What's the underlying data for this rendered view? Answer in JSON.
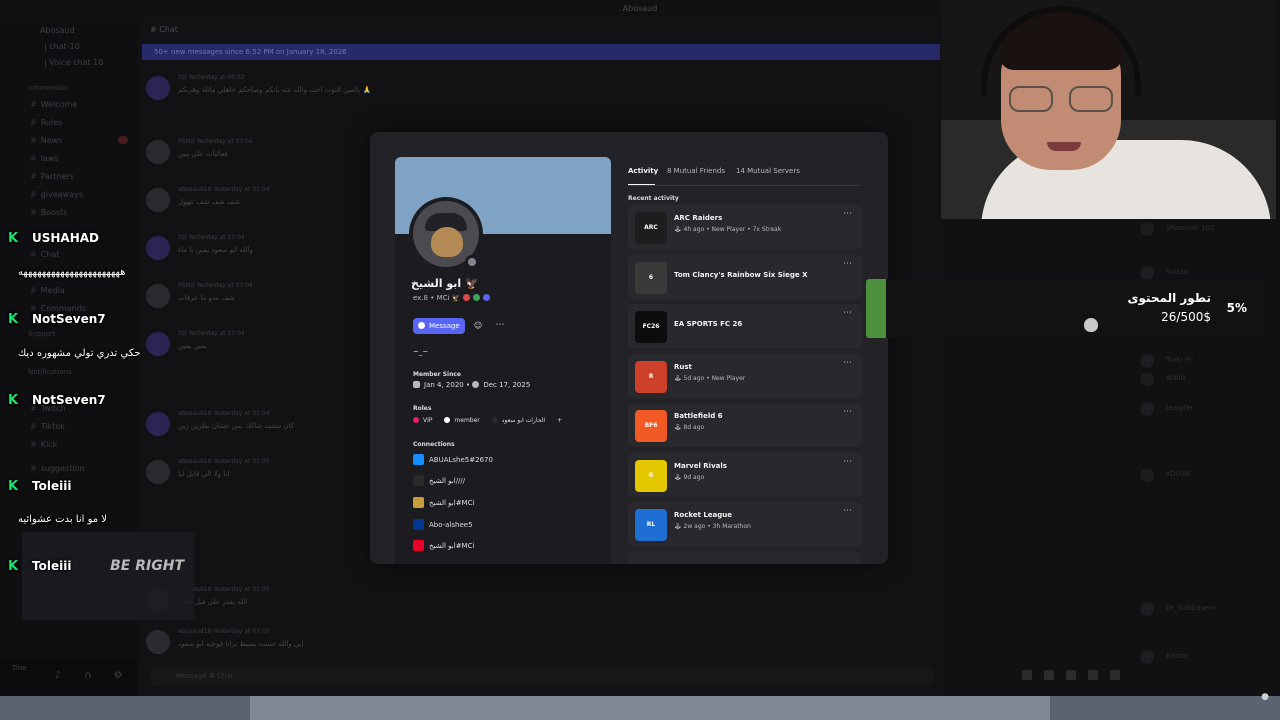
{
  "window": {
    "title": "Abosaud"
  },
  "server": {
    "name": "Abosaud",
    "top_channels": [
      {
        "name": "| chat-10"
      },
      {
        "name": "| Voice chat 10"
      }
    ],
    "categories": {
      "information": "Information",
      "support": "Support",
      "notifications": "Notifications"
    },
    "channels": [
      {
        "name": "Welcome"
      },
      {
        "name": "Rules"
      },
      {
        "name": "News"
      },
      {
        "name": "laws"
      },
      {
        "name": "Partners"
      },
      {
        "name": "giveaways"
      },
      {
        "name": "Boosts"
      },
      {
        "name": "Chat"
      },
      {
        "name": "Media"
      },
      {
        "name": "Commands"
      },
      {
        "name": "Twitch"
      },
      {
        "name": "Tiktok"
      },
      {
        "name": "Kick"
      },
      {
        "name": "suggestion"
      }
    ],
    "user_panel": {
      "status": "Tine"
    }
  },
  "chat": {
    "channel_title": "# Chat",
    "new_messages_bar": "50+ new messages since 6:52 PM on January 18, 2026",
    "input_placeholder": "Message # Chat",
    "messages": [
      {
        "author": "SO",
        "time": "Yesterday at 06:52",
        "text": "بالعين الثوث اخت والله شه بانكم وصاحكم جاهلي مائلة وهريكم 🙏"
      },
      {
        "author": "YSNO",
        "time": "Yesterday at 07:02",
        "text": "فعاليات على مين"
      },
      {
        "author": "abusaud18",
        "time": "Yesterday at 07:04",
        "text": "شف شف شف تتهول"
      },
      {
        "author": "SO",
        "time": "Yesterday at 07:04",
        "text": "والله ابو سعود يمين يا ماء"
      },
      {
        "author": "YSNO",
        "time": "Yesterday at 07:04",
        "text": "شف مدو ما عرقات"
      },
      {
        "author": "SO",
        "time": "Yesterday at 07:04",
        "text": "يمين يمين"
      },
      {
        "author": "abusaud18",
        "time": "Yesterday at 07:04",
        "text": "كان مشت شاكك بس عشان بطرين زين"
      },
      {
        "author": "abusaud18",
        "time": "Yesterday at 07:05",
        "text": "انا ولا الي قابل ليا"
      },
      {
        "author": "abusaud18",
        "time": "Yesterday at 07:05",
        "text": "الله يقدر على قبل الحبر"
      },
      {
        "author": "abusaud18",
        "time": "Yesterday at 07:05",
        "text": "ابي والله حست بسيط ترانا فوجيه ابو سعود"
      }
    ]
  },
  "members": [
    {
      "name": "Shamaah 101"
    },
    {
      "name": "Sultan"
    },
    {
      "name": "Turki 'R'"
    },
    {
      "name": "Walid"
    },
    {
      "name": "teaqifer"
    },
    {
      "name": "YOUSIF"
    },
    {
      "name": "Dr_Gabbaseru"
    },
    {
      "name": "Bados"
    }
  ],
  "stream_chat": [
    {
      "user": "USHAHAD",
      "message": "ههههههههههههههههههههههه"
    },
    {
      "user": "NotSeven7",
      "message": "حكي تدري تولي مشهوره ديك"
    },
    {
      "user": "NotSeven7",
      "message": ""
    },
    {
      "user": "Toleiii",
      "message": "لا مو انا بدت عشوائيه"
    },
    {
      "user": "Toleiii",
      "message": ""
    }
  ],
  "overlay_thumb_text": "BE RIGHT",
  "profile": {
    "display_name": "ابو الشيخ 🦅",
    "username": "ex.8 • MCi 🦅",
    "bio": "~_~",
    "buttons": {
      "message": "Message",
      "add_friend_icon": "add-friend-icon",
      "more_icon": "ellipsis-icon"
    },
    "member_since_label": "Member Since",
    "member_since_discord": "Jan 4, 2020",
    "member_since_server": "Dec 17, 2025",
    "roles_label": "Roles",
    "roles": [
      {
        "name": "VIP",
        "color": "#e91e63"
      },
      {
        "name": "member",
        "color": "#ffffff"
      },
      {
        "name": "الحارات ابو سعود",
        "color": "#2b2b2b"
      }
    ],
    "connections_label": "Connections",
    "connections": [
      {
        "service": "battlenet",
        "name": "ABUALshe5#2670",
        "color": "#148eff"
      },
      {
        "service": "epic",
        "name": "ابو الشيخ////",
        "color": "#2a2a2a"
      },
      {
        "service": "league",
        "name": "ابو الشيخ#MCi",
        "color": "#c89b3c"
      },
      {
        "service": "playstation",
        "name": "Abo-alshee5",
        "color": "#003791"
      },
      {
        "service": "riot",
        "name": "ابو الشيخ#MCi",
        "color": "#eb0029"
      }
    ]
  },
  "activity": {
    "tabs": {
      "activity": "Activity",
      "friends": "8 Mutual Friends",
      "servers": "14 Mutual Servers"
    },
    "recent_label": "Recent activity",
    "games": [
      {
        "name": "ARC Raiders",
        "meta": "🕹 4h ago  •  New Player  •  7x Streak",
        "icon_text": "ARC",
        "color": "#1d1d1d"
      },
      {
        "name": "Tom Clancy's Rainbow Six Siege X",
        "meta": "",
        "icon_text": "6",
        "color": "#3a3a38"
      },
      {
        "name": "EA SPORTS FC 26",
        "meta": "",
        "icon_text": "FC26",
        "color": "#0c0c0c"
      },
      {
        "name": "Rust",
        "meta": "🕹 5d ago  •  New Player",
        "icon_text": "R",
        "color": "#cd412b"
      },
      {
        "name": "Battlefield 6",
        "meta": "🕹 8d ago",
        "icon_text": "BF6",
        "color": "#f15a24"
      },
      {
        "name": "Marvel Rivals",
        "meta": "🕹 9d ago",
        "icon_text": "R",
        "color": "#e5c700"
      },
      {
        "name": "Rocket League",
        "meta": "🕹 2w ago  •  3h Marathon",
        "icon_text": "RL",
        "color": "#1f6ed4"
      }
    ]
  },
  "goal": {
    "title": "تطور المحتوى",
    "amount": "26/500$",
    "percent": "5%",
    "progress_fraction": 0.05,
    "color": "#4c8f3c"
  }
}
